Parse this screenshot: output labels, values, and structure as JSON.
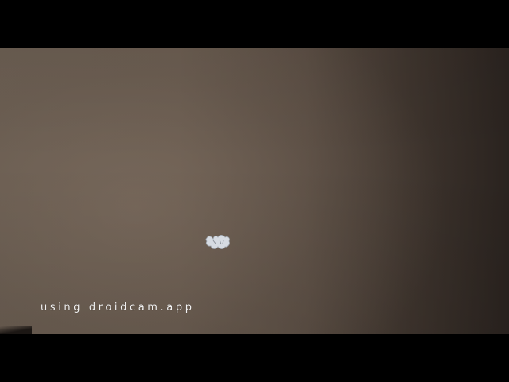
{
  "app": {
    "watermark_text": "using droidcam.app"
  },
  "colors": {
    "letterbox": "#000000",
    "wall_light": "#6b5e52",
    "wall_dark": "#2a231f",
    "watermark": "#f2f2f2"
  },
  "icons": {
    "speck": "wall-speck-icon"
  }
}
